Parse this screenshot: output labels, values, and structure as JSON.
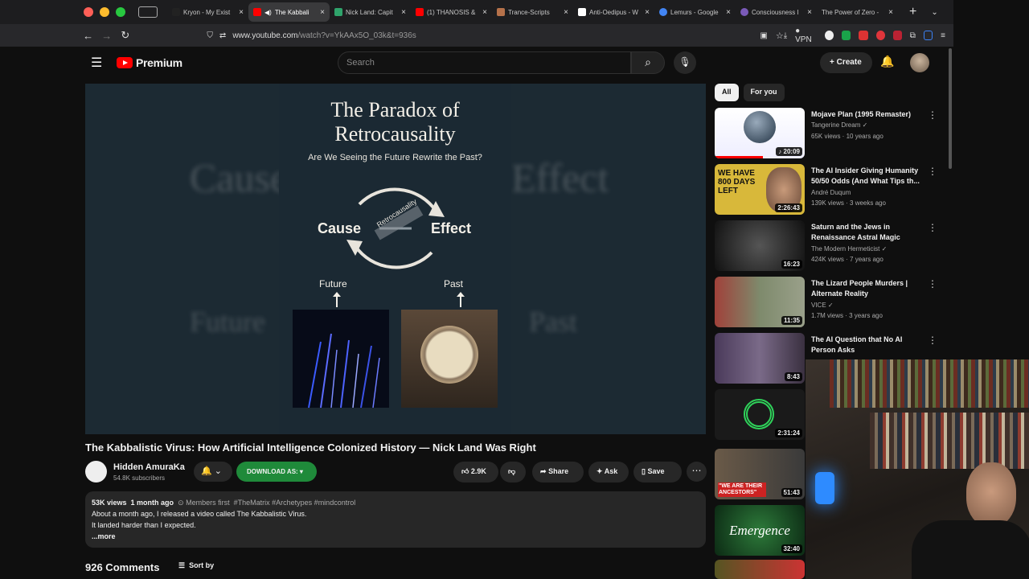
{
  "browser": {
    "tabs": [
      {
        "label": "Kryon - My Exist",
        "icon_color": "#222222"
      },
      {
        "label": "The Kabbali",
        "icon_color": "#ff0000",
        "active": true
      },
      {
        "label": "Nick Land: Capit",
        "icon_color": "#2fa36b"
      },
      {
        "label": "(1) THANOSIS &",
        "icon_color": "#ff0000"
      },
      {
        "label": "Trance-Scripts",
        "icon_color": "#b5714a"
      },
      {
        "label": "Anti-Oedipus - W",
        "icon_color": "#ffffff"
      },
      {
        "label": "Lemurs - Google",
        "icon_color": "#4285f4"
      },
      {
        "label": "Consciousness I",
        "icon_color": "#7a5ab8"
      },
      {
        "label": "The Power of Zero -",
        "icon_color": "#333333"
      }
    ],
    "url_host": "www.youtube.com",
    "url_path": "/watch?v=YkAAx5O_03k&t=936s",
    "vpn_label": "VPN"
  },
  "header": {
    "logo_text": "Premium",
    "search_placeholder": "Search",
    "create_label": "Create"
  },
  "poster": {
    "title_line1": "The Paradox of",
    "title_line2": "Retrocausality",
    "subtitle": "Are We Seeing the Future Rewrite the Past?",
    "cause": "Cause",
    "effect": "Effect",
    "diagonal": "Retrocausality",
    "future": "Future",
    "past": "Past"
  },
  "video": {
    "title": "The Kabbalistic Virus: How Artificial Intelligence Colonized History — Nick Land Was Right",
    "channel": "Hidden AmuraKa",
    "subscribers": "54.8K subscribers",
    "download_label": "DOWNLOAD AS: ▾",
    "likes": "2.9K",
    "share_label": "Share",
    "ask_label": "Ask",
    "save_label": "Save",
    "views": "53K views",
    "age": "1 month ago",
    "members": "Members first",
    "tags": "#TheMatrix #Archetypes #mindcontrol",
    "desc_line1": "About a month ago, I released a video called The Kabbalistic Virus.",
    "desc_line2": "It landed harder than I expected.",
    "more_label": "...more",
    "comments": "926 Comments",
    "sort_label": "Sort by"
  },
  "sidebar": {
    "chips": [
      "All",
      "For you"
    ],
    "recs": [
      {
        "title": "Mojave Plan (1995 Remaster)",
        "channel": "Tangerine Dream",
        "meta": "65K views · 10 years ago",
        "duration": "20:09"
      },
      {
        "title": "The AI Insider Giving Humanity 50/50 Odds (And What Tips th...",
        "channel": "André Duqum",
        "meta": "139K views · 3 weeks ago",
        "duration": "2:26:43",
        "thumb_text": "WE HAVE 800 DAYS LEFT"
      },
      {
        "title": "Saturn and the Jews in Renaissance Astral Magic",
        "channel": "The Modern Hermeticist",
        "meta": "424K views · 7 years ago",
        "duration": "16:23"
      },
      {
        "title": "The Lizard People Murders | Alternate Reality",
        "channel": "VICE",
        "meta": "1.7M views · 3 years ago",
        "duration": "11:35"
      },
      {
        "title": "The AI Question that No AI Person Asks",
        "channel": "",
        "meta": "",
        "duration": "8:43"
      },
      {
        "title": "",
        "channel": "",
        "meta": "",
        "duration": "2:31:24"
      },
      {
        "title": "",
        "channel": "",
        "meta": "",
        "duration": "51:43",
        "thumb_text": "\"WE ARE THEIR ANCESTORS\""
      },
      {
        "title": "",
        "channel": "",
        "meta": "",
        "duration": "32:40",
        "thumb_text": "Emergence"
      }
    ]
  },
  "colors": {
    "youtube_red": "#ff0000",
    "download_green": "#1f8a3a",
    "background": "#0f0f0f"
  }
}
